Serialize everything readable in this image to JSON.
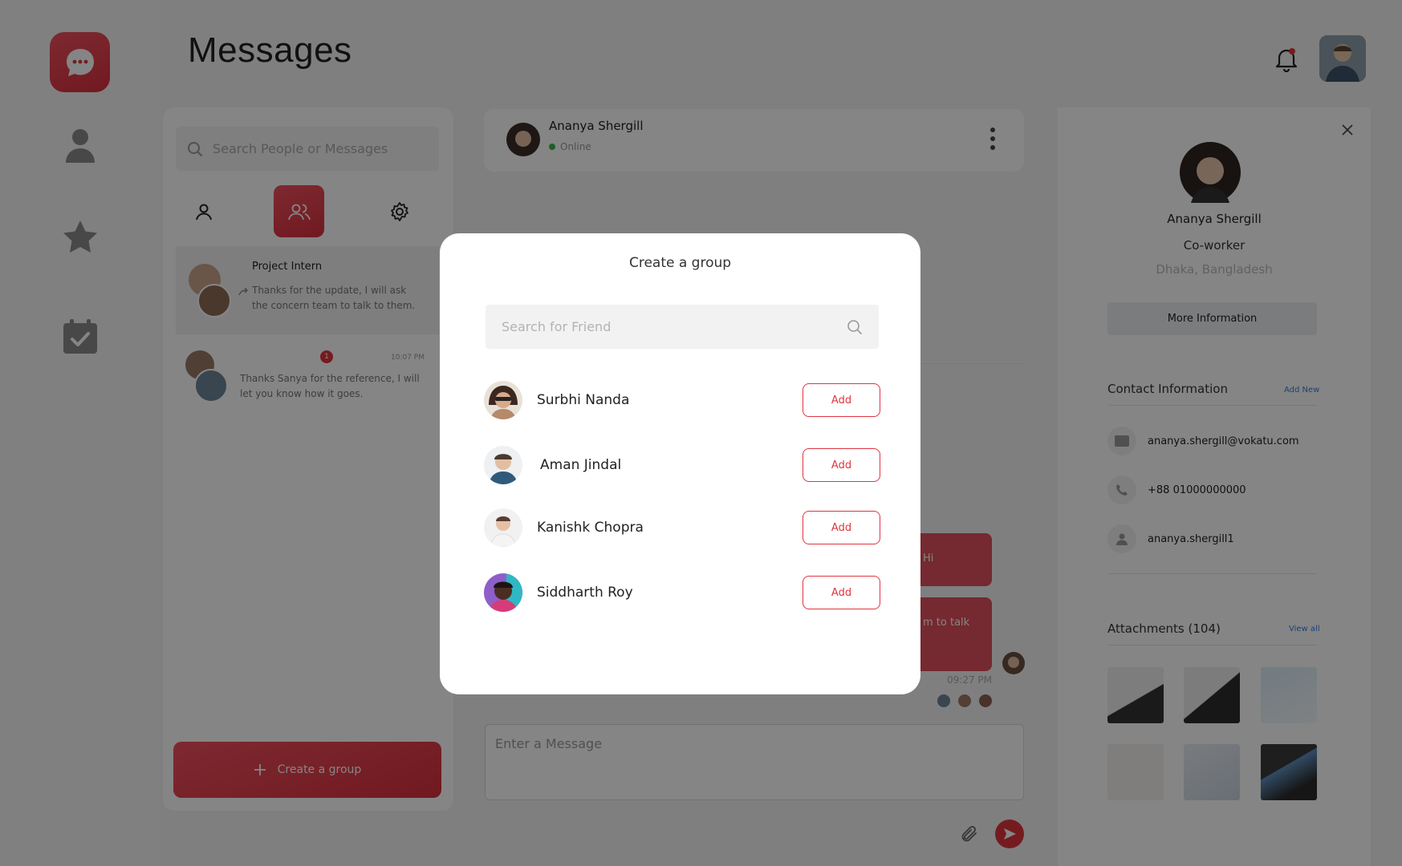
{
  "header": {
    "title": "Messages"
  },
  "sidebar": {
    "icons": [
      "chat-logo-icon",
      "user-icon",
      "star-icon",
      "calendar-check-icon"
    ]
  },
  "conversations": {
    "search_placeholder": "Search People or Messages",
    "items": [
      {
        "name": "Project Intern",
        "message": "Thanks for the update, I will ask the concern team to talk to them."
      },
      {
        "name": "",
        "badge": "1",
        "time": "10:07 PM",
        "message": "Thanks Sanya for the reference, I will let you know how it goes."
      }
    ],
    "create_group_label": "Create a group"
  },
  "chat": {
    "contact_name": "Ananya Shergill",
    "status": "Online",
    "bubbles": [
      "Hi",
      "m to talk"
    ],
    "time": "09:27 PM",
    "input_placeholder": "Enter a Message"
  },
  "profile": {
    "name": "Ananya Shergill",
    "role": "Co-worker",
    "location": "Dhaka, Bangladesh",
    "more_info_label": "More Information",
    "contact_title": "Contact Information",
    "add_new_label": "Add New",
    "email": "ananya.shergill@vokatu.com",
    "phone": "+88 01000000000",
    "username": "ananya.shergill1",
    "attachments_title": "Attachments (104)",
    "view_all_label": "View all"
  },
  "modal": {
    "title": "Create a group",
    "search_placeholder": "Search for Friend",
    "add_label": "Add",
    "friends": [
      {
        "name": "Surbhi Nanda"
      },
      {
        "name": "Aman Jindal"
      },
      {
        "name": "Kanishk Chopra"
      },
      {
        "name": "Siddharth Roy"
      }
    ]
  },
  "colors": {
    "accent": "#e0353f",
    "link": "#3d7bd9",
    "online": "#3cb54a"
  }
}
